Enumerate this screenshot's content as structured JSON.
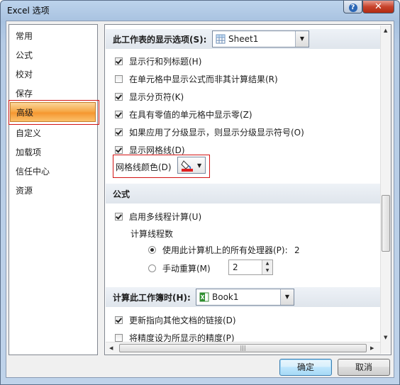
{
  "window": {
    "title": "Excel 选项",
    "help_label": "?",
    "close_label": "✕"
  },
  "nav": {
    "items": [
      {
        "label": "常用"
      },
      {
        "label": "公式"
      },
      {
        "label": "校对"
      },
      {
        "label": "保存"
      },
      {
        "label": "高级",
        "selected": true
      },
      {
        "label": "自定义"
      },
      {
        "label": "加载项"
      },
      {
        "label": "信任中心"
      },
      {
        "label": "资源"
      }
    ]
  },
  "worksheet_section": {
    "title": "此工作表的显示选项(S):",
    "sheet_value": "Sheet1",
    "options": [
      {
        "label": "显示行和列标题(H)",
        "checked": true
      },
      {
        "label": "在单元格中显示公式而非其计算结果(R)",
        "checked": false
      },
      {
        "label": "显示分页符(K)",
        "checked": true
      },
      {
        "label": "在具有零值的单元格中显示零(Z)",
        "checked": true
      },
      {
        "label": "如果应用了分级显示，则显示分级显示符号(O)",
        "checked": true
      },
      {
        "label": "显示网格线(D)",
        "checked": true
      }
    ],
    "gridline_color_label": "网格线颜色(D)",
    "gridline_color": "#e02020"
  },
  "formula_section": {
    "title": "公式",
    "multithread_label": "启用多线程计算(U)",
    "multithread_checked": true,
    "threads_label": "计算线程数",
    "use_all_label": "使用此计算机上的所有处理器(P):",
    "use_all_value": "2",
    "manual_label": "手动重算(M)",
    "manual_value": "2"
  },
  "workbook_section": {
    "title": "计算此工作簿时(H):",
    "book_value": "Book1",
    "options": [
      {
        "label": "更新指向其他文档的链接(D)",
        "checked": true
      },
      {
        "label": "将精度设为所显示的精度(P)",
        "checked": false
      }
    ]
  },
  "buttons": {
    "ok_label": "确定",
    "cancel_label": "取消"
  },
  "colors": {
    "selection_accent": "#f59730",
    "highlight_border": "#d21414"
  }
}
